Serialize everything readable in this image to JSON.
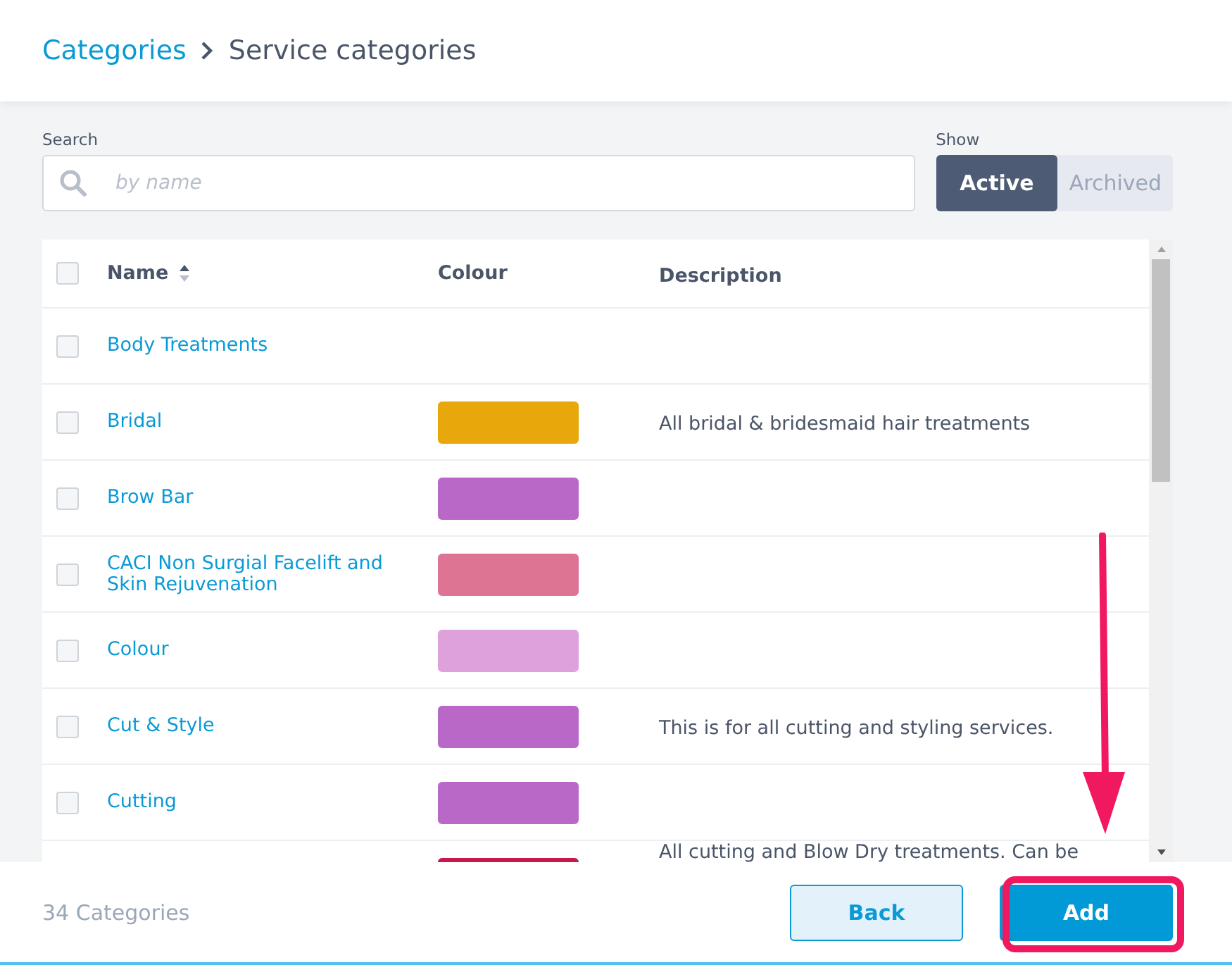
{
  "breadcrumb": {
    "parent": "Categories",
    "current": "Service categories"
  },
  "search": {
    "label": "Search",
    "placeholder": "by name"
  },
  "show": {
    "label": "Show",
    "options": [
      {
        "label": "Active",
        "selected": true
      },
      {
        "label": "Archived",
        "selected": false
      }
    ]
  },
  "table": {
    "columns": [
      "Name",
      "Colour",
      "Description"
    ],
    "header_checked": false,
    "rows": [
      {
        "name": "Body Treatments",
        "checked": false
      },
      {
        "name": "Bridal",
        "color": "#e8a80c",
        "description": "All bridal & bridesmaid hair treatments",
        "checked": false
      },
      {
        "name": "Brow Bar",
        "color": "#b968c8",
        "checked": false
      },
      {
        "name": "CACI Non Surgial Facelift and Skin Rejuvenation",
        "color": "#de7494",
        "checked": false
      },
      {
        "name": "Colour",
        "color": "#dfa1dc",
        "checked": false
      },
      {
        "name": "Cut & Style",
        "color": "#b968c8",
        "description": "This is for all cutting and styling services.",
        "checked": false
      },
      {
        "name": "Cutting",
        "color": "#b968c8",
        "checked": false
      },
      {
        "color": "#c8174a",
        "description": "All cutting and Blow Dry treatments. Can be"
      }
    ]
  },
  "footer": {
    "count": "34 Categories",
    "buttons": [
      {
        "kind": "secondary",
        "label": "Back"
      },
      {
        "kind": "primary",
        "label": "Add"
      }
    ]
  }
}
